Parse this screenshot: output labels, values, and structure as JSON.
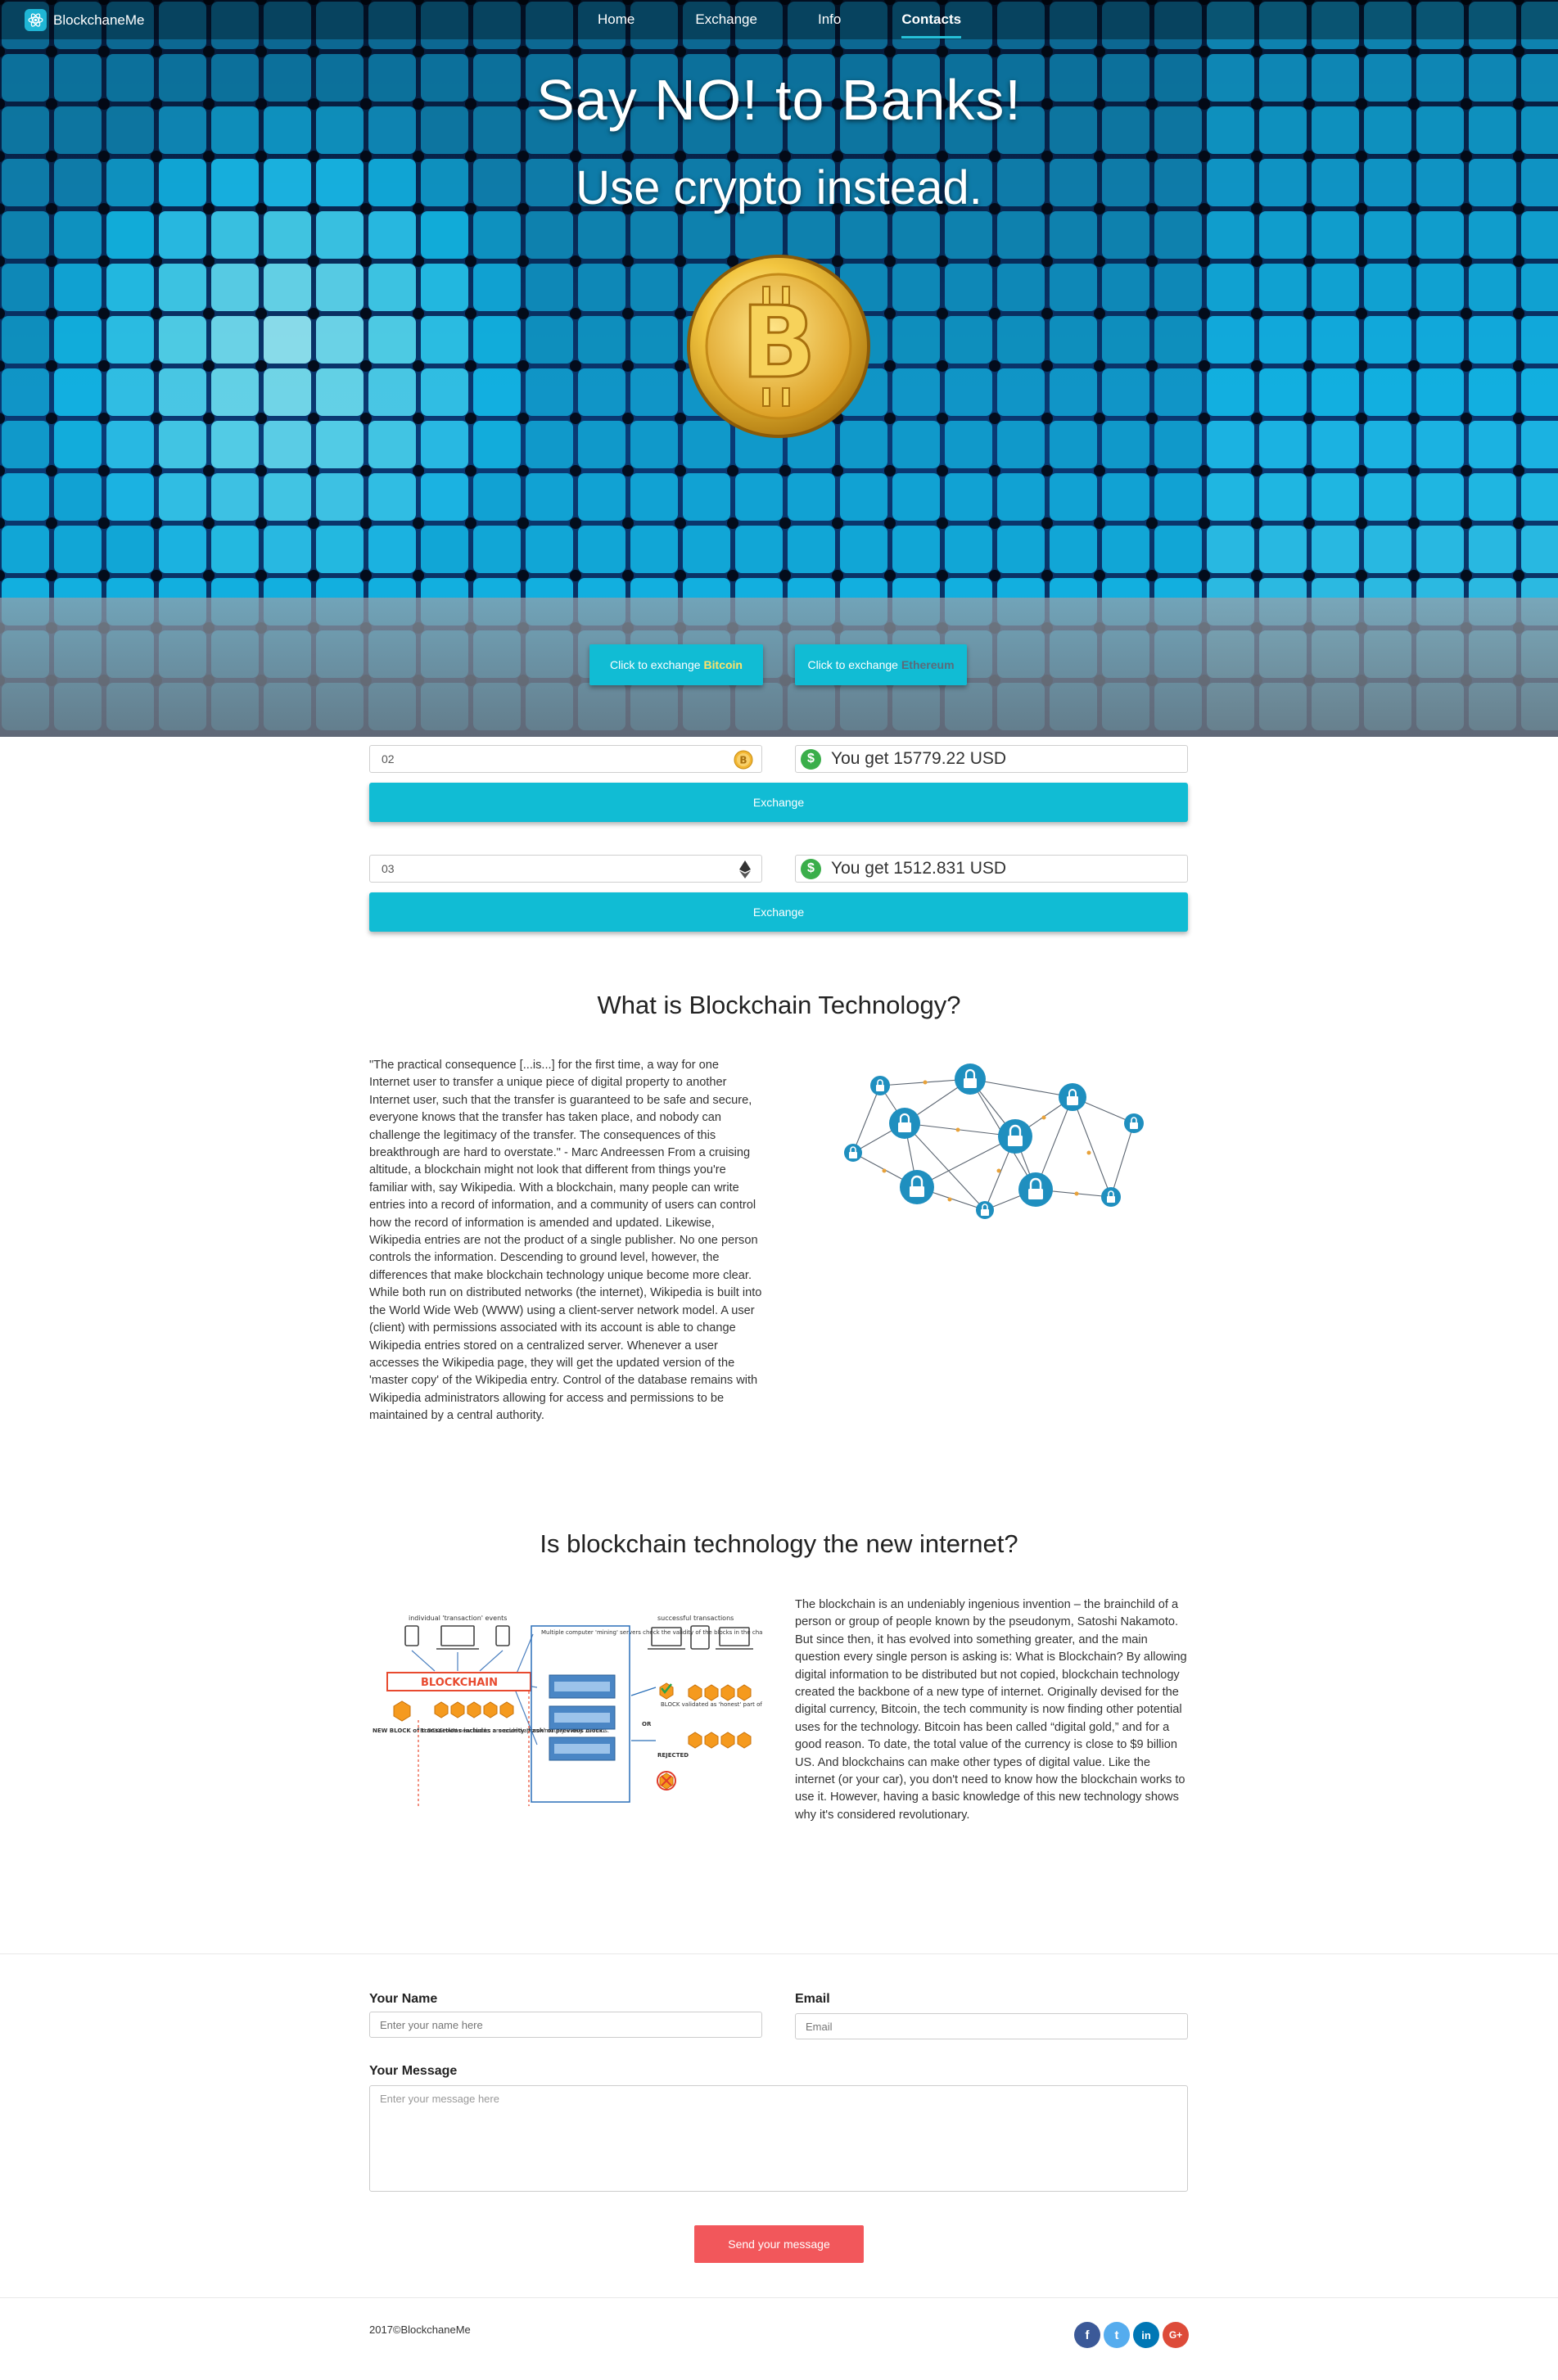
{
  "nav": {
    "brand": "BlockchaneMe",
    "links": [
      "Home",
      "Exchange",
      "Info",
      "Contacts"
    ],
    "active": "Contacts"
  },
  "hero": {
    "title": "Say NO! to Banks!",
    "subtitle": "Use crypto instead.",
    "coin_icon": "bitcoin-coin-icon",
    "btn_btc_prefix": "Click to exchange",
    "btn_btc_coin": "Bitcoin",
    "btn_eth_prefix": "Click to exchange",
    "btn_eth_coin": "Ethereum"
  },
  "exchange": {
    "btc": {
      "amount": "02",
      "result": "You get 15779.22 USD",
      "button": "Exchange",
      "icon": "bitcoin-icon"
    },
    "eth": {
      "amount": "03",
      "result": "You get 1512.831 USD",
      "button": "Exchange",
      "icon": "ethereum-icon"
    }
  },
  "section1": {
    "title": "What is Blockchain Technology?",
    "text": "\"The practical consequence [...is...] for the first time, a way for one Internet user to transfer a unique piece of digital property to another Internet user, such that the transfer is guaranteed to be safe and secure, everyone knows that the transfer has taken place, and nobody can challenge the legitimacy of the transfer. The consequences of this breakthrough are hard to overstate.\" - Marc Andreessen From a cruising altitude, a blockchain might not look that different from things you're familiar with, say Wikipedia. With a blockchain, many people can write entries into a record of information, and a community of users can control how the record of information is amended and updated. Likewise, Wikipedia entries are not the product of a single publisher. No one person controls the information. Descending to ground level, however, the differences that make blockchain technology unique become more clear. While both run on distributed networks (the internet), Wikipedia is built into the World Wide Web (WWW) using a client-server network model. A user (client) with permissions associated with its account is able to change Wikipedia entries stored on a centralized server. Whenever a user accesses the Wikipedia page, they will get the updated version of the 'master copy' of the Wikipedia entry. Control of the database remains with Wikipedia administrators allowing for access and permissions to be maintained by a central authority."
  },
  "section2": {
    "title": "Is blockchain technology the new internet?",
    "text": "The blockchain is an undeniably ingenious invention – the brainchild of a person or group of people known by the pseudonym, Satoshi Nakamoto. But since then, it has evolved into something greater, and the main question every single person is asking is: What is Blockchain? By allowing digital information to be distributed but not copied, blockchain technology created the backbone of a new type of internet. Originally devised for the digital currency, Bitcoin, the tech community is now finding other potential uses for the technology. Bitcoin has been called “digital gold,” and for a good reason. To date, the total value of the currency is close to $9 billion US. And blockchains can make other types of digital value. Like the internet (or your car), you don't need to know how the blockchain works to use it. However, having a basic knowledge of this new technology shows why it's considered revolutionary.",
    "diagram": {
      "top_left": "individual 'transaction' events",
      "top_right": "successful transactions",
      "banner": "BLOCKCHAIN",
      "mining": "Multiple computer 'mining' servers check the validity of the blocks in the chain. The quickest to check the latest block, gets payment",
      "new_block": "NEW BLOCK of transactions includes a security 'hash' of previous block.",
      "added": "BLOCKCHAIN new blocks are added approximately every 10 mins.",
      "or": "OR",
      "validated": "BLOCK validated as 'honest' part of the chain.",
      "rejected": "REJECTED"
    }
  },
  "contact": {
    "name_label": "Your Name",
    "name_placeholder": "Enter your name here",
    "email_label": "Email",
    "email_placeholder": "Email",
    "message_label": "Your Message",
    "message_placeholder": "Enter your message here",
    "send": "Send your message"
  },
  "footer": {
    "copyright": "2017©BlockchaneMe",
    "social": [
      {
        "icon": "facebook-icon",
        "glyph": "f",
        "color": "#3b5998"
      },
      {
        "icon": "twitter-icon",
        "glyph": "t",
        "color": "#55acee"
      },
      {
        "icon": "linkedin-icon",
        "glyph": "in",
        "color": "#0077b5"
      },
      {
        "icon": "google-plus-icon",
        "glyph": "G+",
        "color": "#dd4b39"
      }
    ]
  },
  "colors": {
    "accent": "#11bcd4",
    "send": "#f2575b",
    "hero_dark": "#051a3a"
  }
}
